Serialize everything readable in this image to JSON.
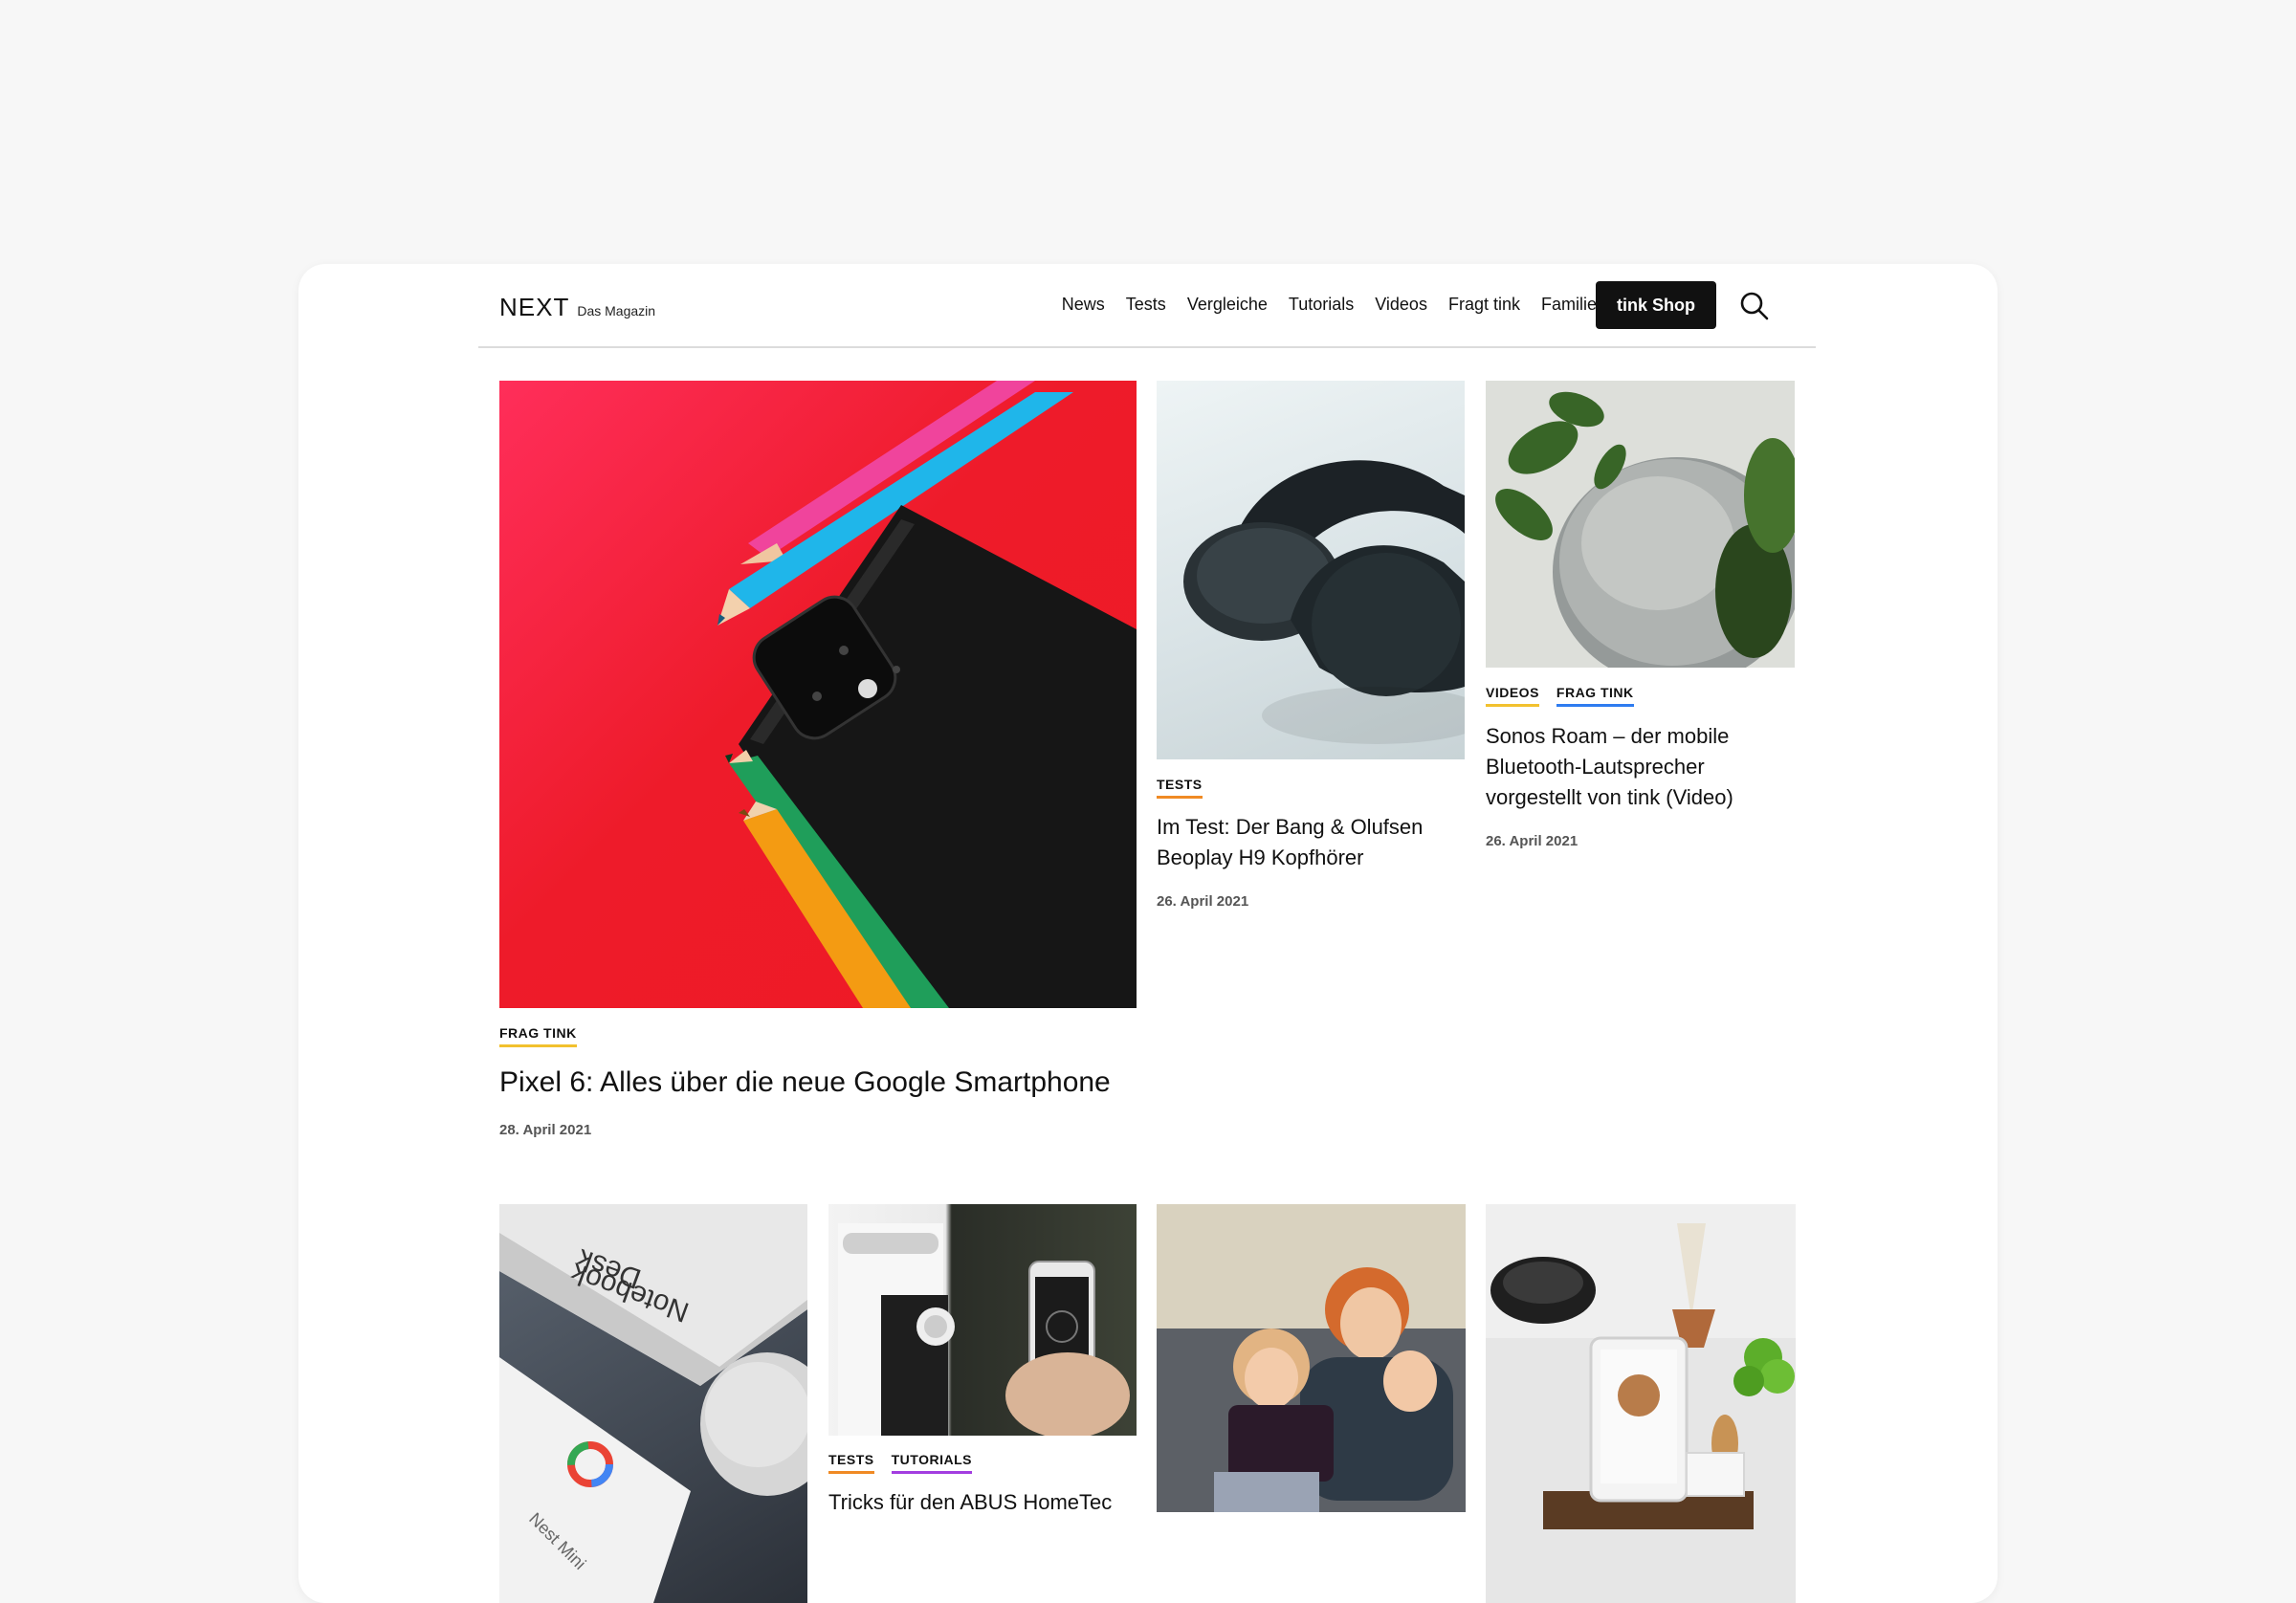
{
  "brand": {
    "name": "NEXT",
    "tagline": "Das Magazin"
  },
  "nav": {
    "items": [
      "News",
      "Tests",
      "Vergleiche",
      "Tutorials",
      "Videos",
      "Fragt tink",
      "Familie Sill"
    ],
    "shop_label": "tink Shop"
  },
  "articles": [
    {
      "tags": [
        "FRAG TINK"
      ],
      "title": "Pixel 6: Alles über die neue Google Smartphone",
      "date": "28. April 2021"
    },
    {
      "tags": [
        "TESTS"
      ],
      "title": "Im Test: Der Bang & Olufsen Beoplay H9 Kopfhörer",
      "date": "26. April 2021"
    },
    {
      "tags": [
        "VIDEOS",
        "FRAG TINK"
      ],
      "title": "Sonos Roam – der mobile Bluetooth-Lautsprecher vorgestellt von tink (Video)",
      "date": "26. April 2021"
    },
    {
      "tags": [
        "TESTS",
        "TUTORIALS"
      ],
      "title": "Tricks für den ABUS HomeTec",
      "date": ""
    }
  ],
  "image_texts": {
    "notebook_text_1": "Desk",
    "notebook_text_2": "Notebook",
    "box_text": "Nest Mini"
  },
  "colors": {
    "accent_orange": "#f08a24",
    "accent_blue": "#2e7cf0",
    "accent_purple": "#a33de0",
    "accent_yellow": "#f2c12e",
    "button_bg": "#111111"
  }
}
